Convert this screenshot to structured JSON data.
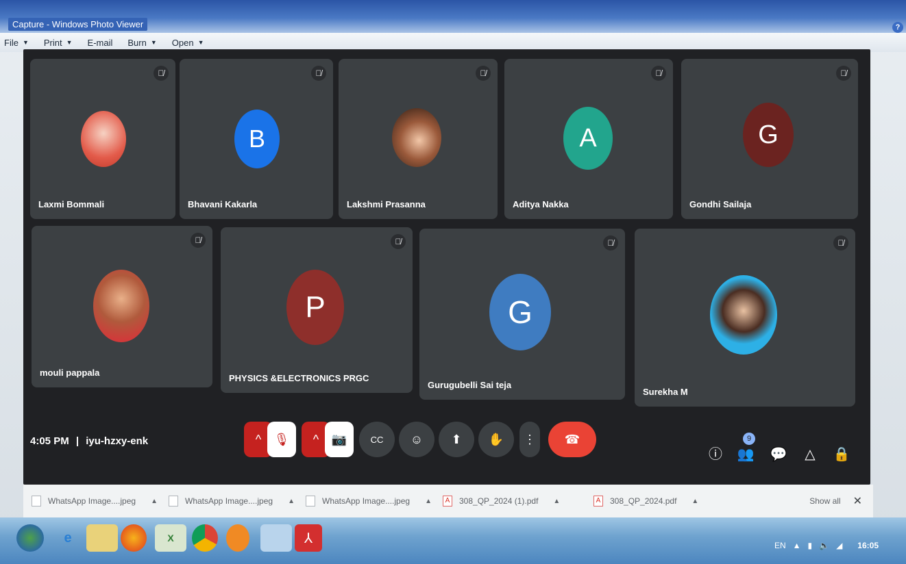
{
  "window": {
    "title": "Capture - Windows Photo Viewer",
    "help_label": "?"
  },
  "menubar": {
    "items": [
      "File",
      "Print",
      "E-mail",
      "Burn",
      "Open"
    ]
  },
  "meet": {
    "tiles": [
      {
        "name": "Laxmi Bommali",
        "avatar_type": "photo",
        "avatar_color": "#e35b4a"
      },
      {
        "name": "Bhavani Kakarla",
        "avatar_type": "letter",
        "letter": "B",
        "avatar_color": "#1a73e8"
      },
      {
        "name": "Lakshmi Prasanna",
        "avatar_type": "photo",
        "avatar_color": "#7a4a2c"
      },
      {
        "name": "Aditya Nakka",
        "avatar_type": "letter",
        "letter": "A",
        "avatar_color": "#22a58d"
      },
      {
        "name": "Gondhi Sailaja",
        "avatar_type": "letter",
        "letter": "G",
        "avatar_color": "#6b2320"
      },
      {
        "name": "mouli pappala",
        "avatar_type": "photo",
        "avatar_color": "#b05a3c"
      },
      {
        "name": "PHYSICS &ELECTRONICS PRGC",
        "avatar_type": "letter",
        "letter": "P",
        "avatar_color": "#8e2f2b"
      },
      {
        "name": "Gurugubelli Sai teja",
        "avatar_type": "letter",
        "letter": "G",
        "avatar_color": "#3f7cc1"
      },
      {
        "name": "Surekha M",
        "avatar_type": "photo",
        "avatar_color": "#2db0e6"
      }
    ],
    "clock": "4:05 PM",
    "meeting_code": "iyu-hzxy-enk",
    "clock_separator": "|",
    "participant_count": "9",
    "icons": {
      "mic_off": "🎙",
      "camera_off": "📷",
      "captions": "CC",
      "emoji": "☺",
      "present": "⬆",
      "raise_hand": "✋",
      "more": "⋮",
      "hangup": "☎",
      "info": "ⓘ",
      "people": "👥",
      "chat": "💬",
      "activities": "△",
      "host": "🔒",
      "caret_up": "^"
    }
  },
  "downloads": {
    "items": [
      {
        "name": "WhatsApp Image....jpeg",
        "type": "image"
      },
      {
        "name": "WhatsApp Image....jpeg",
        "type": "image"
      },
      {
        "name": "WhatsApp Image....jpeg",
        "type": "image"
      },
      {
        "name": "308_QP_2024 (1).pdf",
        "type": "pdf"
      },
      {
        "name": "308_QP_2024.pdf",
        "type": "pdf"
      }
    ],
    "show_all": "Show all",
    "close": "✕"
  },
  "taskbar": {
    "tray_lang": "EN",
    "tray_time": "16:05"
  }
}
